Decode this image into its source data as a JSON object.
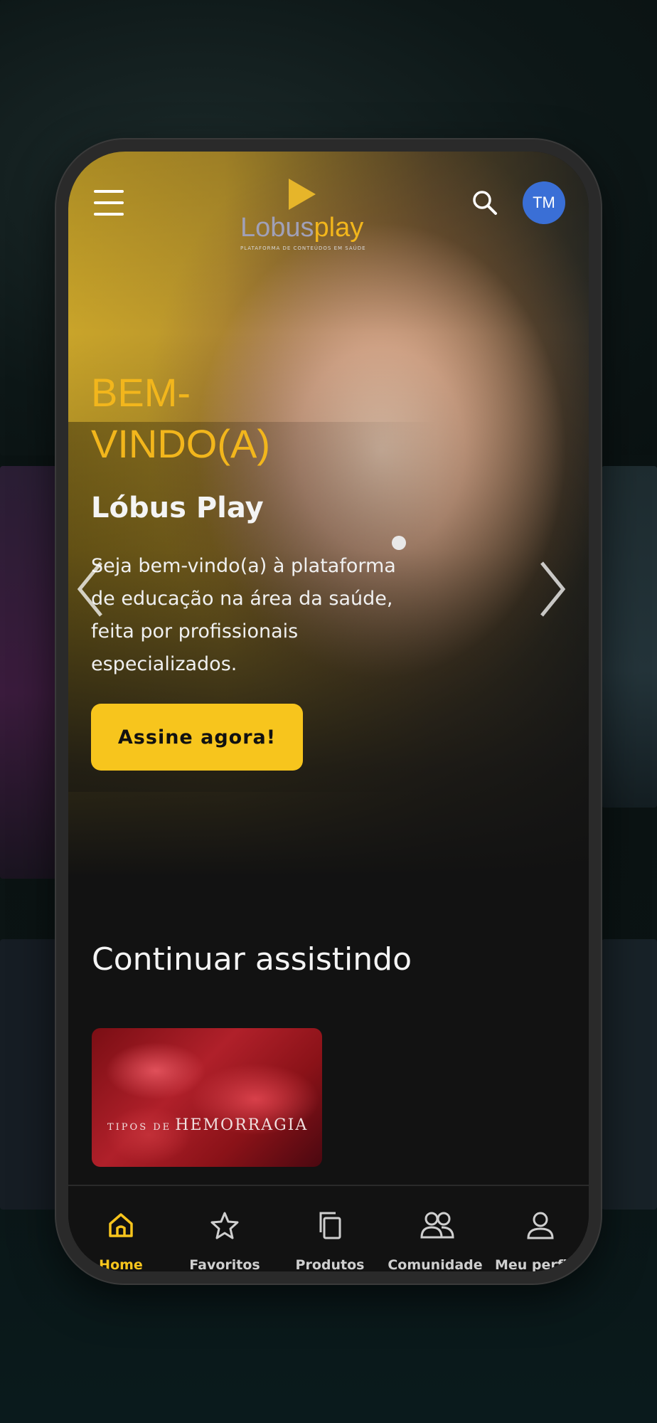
{
  "header": {
    "logo": {
      "word_a": "Lobus",
      "word_b": "play",
      "tagline": "PLATAFORMA DE CONTEÚDOS EM SAÚDE"
    },
    "avatar_initials": "TM",
    "icons": {
      "menu": "hamburger-menu-icon",
      "search": "search-icon"
    }
  },
  "hero": {
    "welcome": "BEM-VINDO(A)",
    "brand": "Lóbus Play",
    "description": "Seja bem-vindo(a) à plataforma de educação na área da saúde, feita por profissionais especializados.",
    "cta_label": "Assine agora!"
  },
  "continue_watching": {
    "title": "Continuar assistindo",
    "items": [
      {
        "label_small": "TIPOS DE",
        "label_large": "HEMORRAGIA"
      }
    ]
  },
  "bottom_nav": {
    "items": [
      {
        "label": "Home",
        "icon": "home-icon",
        "active": true
      },
      {
        "label": "Favoritos",
        "icon": "star-icon",
        "active": false
      },
      {
        "label": "Produtos",
        "icon": "copy-icon",
        "active": false
      },
      {
        "label": "Comunidade",
        "icon": "users-icon",
        "active": false
      },
      {
        "label": "Meu perfil",
        "icon": "user-icon",
        "active": false
      }
    ]
  },
  "colors": {
    "accent": "#f7c51d",
    "avatar": "#3a6fd6",
    "background": "#121212"
  }
}
